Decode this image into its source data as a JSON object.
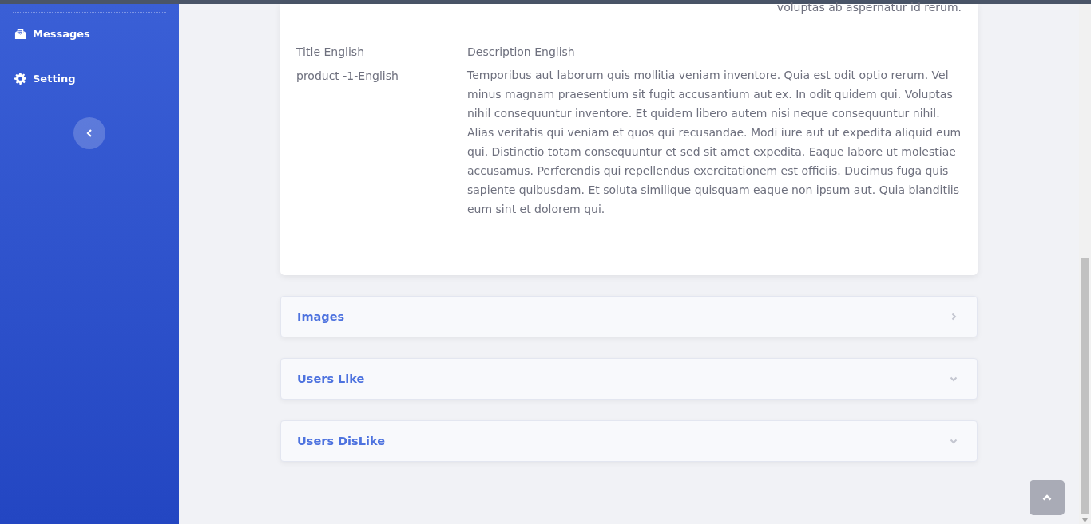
{
  "sidebar": {
    "items": [
      {
        "label": "Messages",
        "kind": "messages"
      },
      {
        "label": "Setting",
        "kind": "setting"
      }
    ]
  },
  "product_card": {
    "previous_text_tail": "voluptas ab aspernatur id rerum.",
    "columns": [
      "Title English",
      "Description English"
    ],
    "row": {
      "title": "product -1-English",
      "description": "Temporibus aut laborum quis mollitia veniam inventore. Quia est odit optio rerum. Vel minus magnam praesentium sit fugit accusantium aut ex. In odit quidem qui. Voluptas nihil consequuntur inventore. Et quidem libero autem nisi neque consequuntur nihil. Alias veritatis qui veniam et quos qui recusandae. Modi iure aut ut expedita aliquid eum qui. Distinctio totam consequuntur et sed sit amet expedita. Eaque labore ut molestiae accusamus. Perferendis qui repellendus exercitationem est officiis. Ducimus fuga quis sapiente quibusdam. Et soluta similique quisquam eaque non ipsum aut. Quia blanditiis eum sint et dolorem qui."
    }
  },
  "panels": [
    {
      "title": "Images",
      "expanded": false
    },
    {
      "title": "Users Like",
      "expanded": true
    },
    {
      "title": "Users DisLike",
      "expanded": true
    }
  ]
}
